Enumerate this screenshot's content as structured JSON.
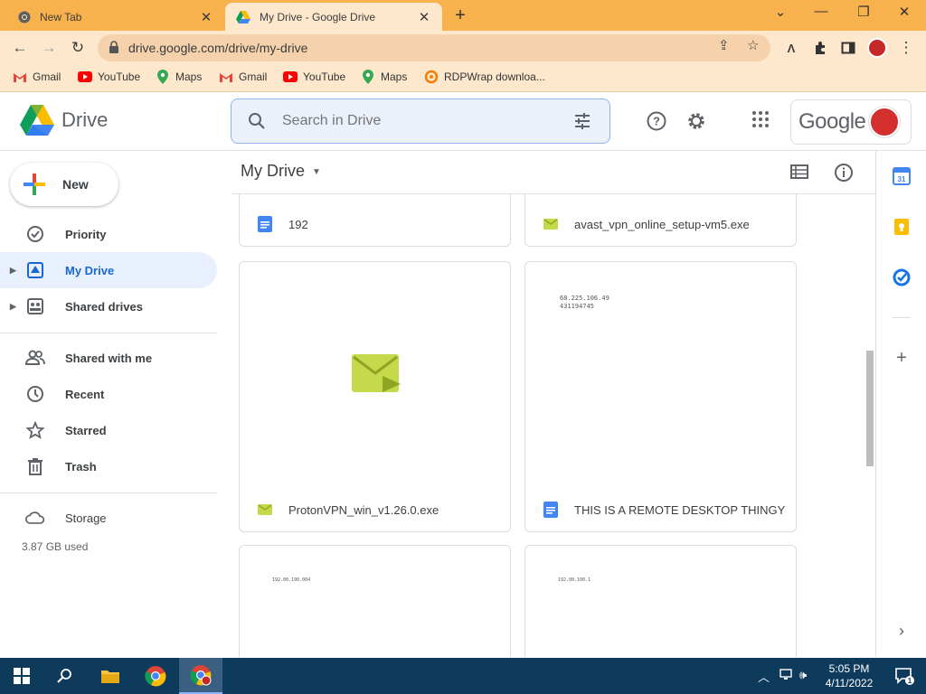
{
  "browser": {
    "tabs": [
      {
        "title": "New Tab",
        "active": false
      },
      {
        "title": "My Drive - Google Drive",
        "active": true
      }
    ],
    "url": "drive.google.com/drive/my-drive",
    "bookmarks": [
      {
        "label": "Gmail",
        "icon": "gmail-icon"
      },
      {
        "label": "YouTube",
        "icon": "youtube-icon"
      },
      {
        "label": "Maps",
        "icon": "maps-icon"
      },
      {
        "label": "Gmail",
        "icon": "gmail-icon"
      },
      {
        "label": "YouTube",
        "icon": "youtube-icon"
      },
      {
        "label": "Maps",
        "icon": "maps-icon"
      },
      {
        "label": "RDPWrap downloa...",
        "icon": "rdpwrap-icon"
      }
    ],
    "frame_color": "#f7b14d"
  },
  "header": {
    "product_name": "Drive",
    "search_placeholder": "Search in Drive",
    "account_brand": "Google"
  },
  "sidebar": {
    "new_label": "New",
    "items": [
      {
        "label": "Priority",
        "icon": "priority-icon"
      },
      {
        "label": "My Drive",
        "icon": "my-drive-icon",
        "active": true
      },
      {
        "label": "Shared drives",
        "icon": "shared-drives-icon"
      },
      {
        "label": "Shared with me",
        "icon": "people-icon"
      },
      {
        "label": "Recent",
        "icon": "clock-icon"
      },
      {
        "label": "Starred",
        "icon": "star-icon"
      },
      {
        "label": "Trash",
        "icon": "trash-icon"
      },
      {
        "label": "Storage",
        "icon": "cloud-icon"
      }
    ],
    "storage_used": "3.87 GB used"
  },
  "main": {
    "title": "My Drive",
    "files": [
      {
        "name": "192",
        "type": "doc"
      },
      {
        "name": "avast_vpn_online_setup-vm5.exe",
        "type": "exe"
      },
      {
        "name": "ProtonVPN_win_v1.26.0.exe",
        "type": "exe"
      },
      {
        "name": "THIS IS A REMOTE DESKTOP THINGY",
        "type": "doc",
        "preview_lines": [
          "68.225.106.49",
          "431194745"
        ]
      },
      {
        "name": "",
        "type": "doc",
        "preview_lines": [
          "192.00.190.004"
        ]
      },
      {
        "name": "",
        "type": "doc",
        "preview_lines": [
          "192.00.100.1"
        ]
      }
    ]
  },
  "taskbar": {
    "time": "5:05 PM",
    "date": "4/11/2022",
    "notification_count": "1"
  },
  "colors": {
    "accent_blue": "#1967d2",
    "active_nav_bg": "#e8f0fe",
    "exe_green": "#c5d94a",
    "doc_blue": "#4285f4",
    "taskbar": "#0e3a5c"
  }
}
